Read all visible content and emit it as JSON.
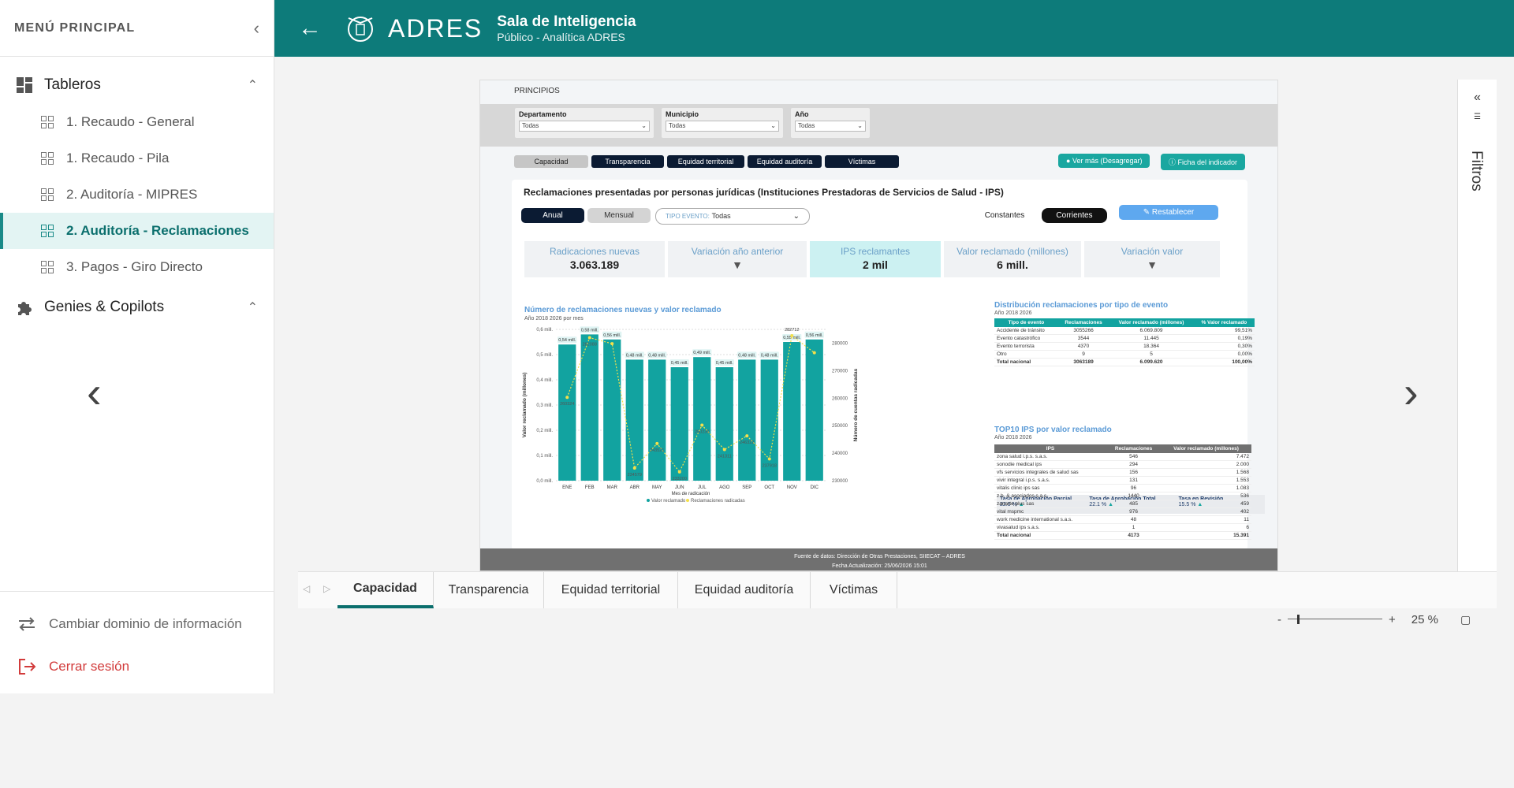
{
  "sidebar": {
    "title": "MENÚ PRINCIPAL",
    "groups": [
      {
        "label": "Tableros",
        "icon": "dashboard-icon"
      },
      {
        "label": "Genies & Copilots",
        "icon": "puzzle-icon"
      }
    ],
    "items": [
      {
        "label": "1. Recaudo - General"
      },
      {
        "label": "1. Recaudo - Pila"
      },
      {
        "label": "2. Auditoría - MIPRES"
      },
      {
        "label": "2. Auditoría - Reclamaciones"
      },
      {
        "label": "3. Pagos - Giro Directo"
      }
    ],
    "footer": {
      "domain": "Cambiar dominio de información",
      "logout": "Cerrar sesión"
    }
  },
  "header": {
    "brand": "ADRES",
    "title": "Sala de Inteligencia",
    "subtitle": "Público - Analítica ADRES",
    "accent": "#0d7b7a"
  },
  "report": {
    "section": "PRINCIPIOS",
    "filters": [
      {
        "label": "Departamento",
        "value": "Todas"
      },
      {
        "label": "Municipio",
        "value": "Todas"
      },
      {
        "label": "Año",
        "value": "Todas"
      }
    ],
    "tabs": [
      "Capacidad",
      "Transparencia",
      "Equidad territorial",
      "Equidad auditoría",
      "Víctimas"
    ],
    "ver_mas": "Ver más (Desagregar)",
    "ficha": "Ficha del indicador",
    "card_title": "Reclamaciones presentadas por personas jurídicas (Instituciones Prestadoras de Servicios de Salud - IPS)",
    "anual": "Anual",
    "mensual": "Mensual",
    "tipo_label": "TIPO EVENTO:",
    "tipo_value": "Todas",
    "constantes": "Constantes",
    "corrientes": "Corrientes",
    "restablecer": "Restablecer",
    "kpis": [
      {
        "label": "Radicaciones nuevas",
        "value": "3.063.189"
      },
      {
        "label": "Variación año anterior",
        "value": "▼"
      },
      {
        "label": "IPS reclamantes",
        "value": "2 mil"
      },
      {
        "label": "Valor reclamado (millones)",
        "value": "6 mill."
      },
      {
        "label": "Variación valor",
        "value": "▼"
      }
    ],
    "dist_title": "Distribución reclamaciones por tipo de evento",
    "dist_sub": "Año 2018 2026",
    "dist_cols": [
      "Tipo de evento",
      "Reclamaciones",
      "Valor reclamado (millones)",
      "% Valor reclamado"
    ],
    "dist_rows": [
      [
        "Accidente de tránsito",
        "3055266",
        "6.069.809",
        "99,51%"
      ],
      [
        "Evento catastrófico",
        "3544",
        "11.445",
        "0,19%"
      ],
      [
        "Evento terrorista",
        "4370",
        "18.364",
        "0,30%"
      ],
      [
        "Otro",
        "9",
        "5",
        "0,00%"
      ],
      [
        "Total nacional",
        "3063189",
        "6.099.620",
        "100,00%"
      ]
    ],
    "rates": [
      {
        "label": "Tasa de Aprobación Parcial",
        "value": "22.9 %"
      },
      {
        "label": "Tasa de Aprobación Total",
        "value": "22.1 %"
      },
      {
        "label": "Tasa en Revisión",
        "value": "15.5 %"
      }
    ],
    "top_title": "TOP10 IPS por valor reclamado",
    "top_sub": "Año 2018 2026",
    "top_cols": [
      "IPS",
      "Reclamaciones",
      "Valor reclamado (millones)"
    ],
    "top_rows": [
      [
        "zona salud i.p.s. s.a.s.",
        "546",
        "7.472"
      ],
      [
        "sonodie medical ips",
        "294",
        "2.000"
      ],
      [
        "vfs servicios integrales de salud sas",
        "156",
        "1.568"
      ],
      [
        "vivir integral i.p.s. s.a.s.",
        "131",
        "1.553"
      ],
      [
        "vitalis clinic ips sas",
        "96",
        "1.083"
      ],
      [
        "z.b. & asociados s.a.s.",
        "1440",
        "536"
      ],
      [
        "zanarte plus sas",
        "485",
        "459"
      ],
      [
        "vital mspmc",
        "976",
        "402"
      ],
      [
        "work medicine international s.a.s.",
        "48",
        "11"
      ],
      [
        "vivasalud ips s.a.s.",
        "1",
        "6"
      ],
      [
        "Total nacional",
        "4173",
        "15.391"
      ]
    ],
    "source": "Fuente de datos: Dirección de Otras Prestaciones, SIIECAT – ADRES",
    "updated": "Fecha Actualización: 25/06/2026 15:01"
  },
  "chart_data": {
    "type": "bar",
    "title": "Número de reclamaciones nuevas  y valor reclamado",
    "subtitle": "Año 2018 2026 por mes",
    "xlabel": "Mes de radicación",
    "ylabel": "Valor reclamado (millones)",
    "y2label": "Número de cuentas radicadas",
    "categories": [
      "ENE",
      "FEB",
      "MAR",
      "ABR",
      "MAY",
      "JUN",
      "JUL",
      "AGO",
      "SEP",
      "OCT",
      "NOV",
      "DIC"
    ],
    "ylim": [
      0,
      0.6
    ],
    "y_ticks": [
      "0,0 mill.",
      "0,1 mill.",
      "0,2 mill.",
      "0,3 mill.",
      "0,4 mill.",
      "0,5 mill.",
      "0,6 mill."
    ],
    "y2lim": [
      230000,
      285000
    ],
    "y2_ticks": [
      "230000",
      "240000",
      "250000",
      "260000",
      "270000",
      "280000"
    ],
    "series": [
      {
        "name": "Valor reclamado",
        "type": "bar",
        "color": "#12a3a0",
        "values": [
          0.54,
          0.58,
          0.56,
          0.48,
          0.48,
          0.45,
          0.49,
          0.45,
          0.48,
          0.48,
          0.55,
          0.56
        ],
        "labels": [
          "0,54 mill.",
          "0,58 mill.",
          "0,56 mill.",
          "0,48 mill.",
          "0,48 mill.",
          "0,45 mill.",
          "0,49 mill.",
          "0,45 mill.",
          "0,48 mill.",
          "0,48 mill.",
          "0,55 mill.",
          "0,56 mill."
        ]
      },
      {
        "name": "Reclamaciones radicadas",
        "type": "line",
        "color": "#f5e04a",
        "values": [
          260300,
          282000,
          279800,
          234600,
          243500,
          233200,
          250200,
          241300,
          246300,
          237900,
          282712,
          276500
        ]
      }
    ],
    "point_labels": [
      "260324",
      "282088",
      "",
      "234579",
      "243521",
      "233200",
      "250230",
      "241311",
      "246322",
      "237918",
      "282712",
      ""
    ]
  }
}
